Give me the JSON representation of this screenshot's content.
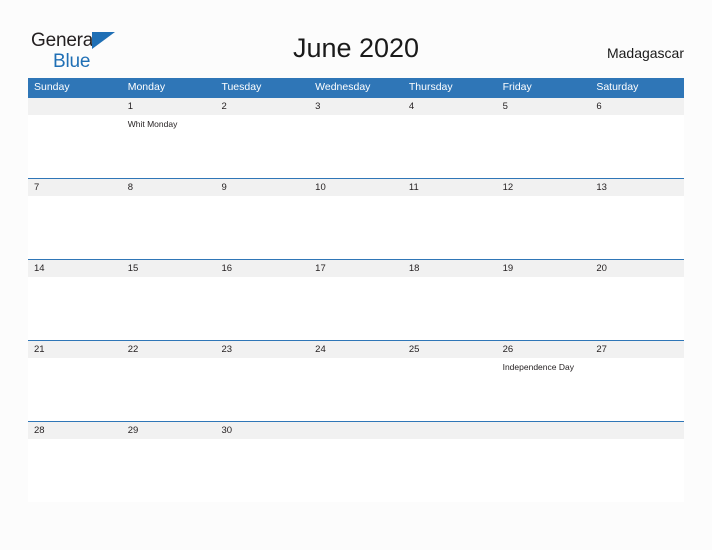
{
  "logo": {
    "word1": "General",
    "word2": "Blue",
    "triangle_color": "#1f6fb5",
    "text_color": "#231f20"
  },
  "header": {
    "title": "June 2020",
    "country": "Madagascar"
  },
  "theme": {
    "header_blue": "#2f76b7",
    "band_gray": "#f1f1f1",
    "page_background": "#fcfcfc",
    "text": "#231f20"
  },
  "calendar": {
    "weekdays": [
      "Sunday",
      "Monday",
      "Tuesday",
      "Wednesday",
      "Thursday",
      "Friday",
      "Saturday"
    ],
    "weeks": [
      {
        "days": [
          {
            "number": "",
            "event": ""
          },
          {
            "number": "1",
            "event": "Whit Monday"
          },
          {
            "number": "2",
            "event": ""
          },
          {
            "number": "3",
            "event": ""
          },
          {
            "number": "4",
            "event": ""
          },
          {
            "number": "5",
            "event": ""
          },
          {
            "number": "6",
            "event": ""
          }
        ]
      },
      {
        "days": [
          {
            "number": "7",
            "event": ""
          },
          {
            "number": "8",
            "event": ""
          },
          {
            "number": "9",
            "event": ""
          },
          {
            "number": "10",
            "event": ""
          },
          {
            "number": "11",
            "event": ""
          },
          {
            "number": "12",
            "event": ""
          },
          {
            "number": "13",
            "event": ""
          }
        ]
      },
      {
        "days": [
          {
            "number": "14",
            "event": ""
          },
          {
            "number": "15",
            "event": ""
          },
          {
            "number": "16",
            "event": ""
          },
          {
            "number": "17",
            "event": ""
          },
          {
            "number": "18",
            "event": ""
          },
          {
            "number": "19",
            "event": ""
          },
          {
            "number": "20",
            "event": ""
          }
        ]
      },
      {
        "days": [
          {
            "number": "21",
            "event": ""
          },
          {
            "number": "22",
            "event": ""
          },
          {
            "number": "23",
            "event": ""
          },
          {
            "number": "24",
            "event": ""
          },
          {
            "number": "25",
            "event": ""
          },
          {
            "number": "26",
            "event": "Independence Day"
          },
          {
            "number": "27",
            "event": ""
          }
        ]
      },
      {
        "days": [
          {
            "number": "28",
            "event": ""
          },
          {
            "number": "29",
            "event": ""
          },
          {
            "number": "30",
            "event": ""
          },
          {
            "number": "",
            "event": ""
          },
          {
            "number": "",
            "event": ""
          },
          {
            "number": "",
            "event": ""
          },
          {
            "number": "",
            "event": ""
          }
        ]
      }
    ]
  }
}
